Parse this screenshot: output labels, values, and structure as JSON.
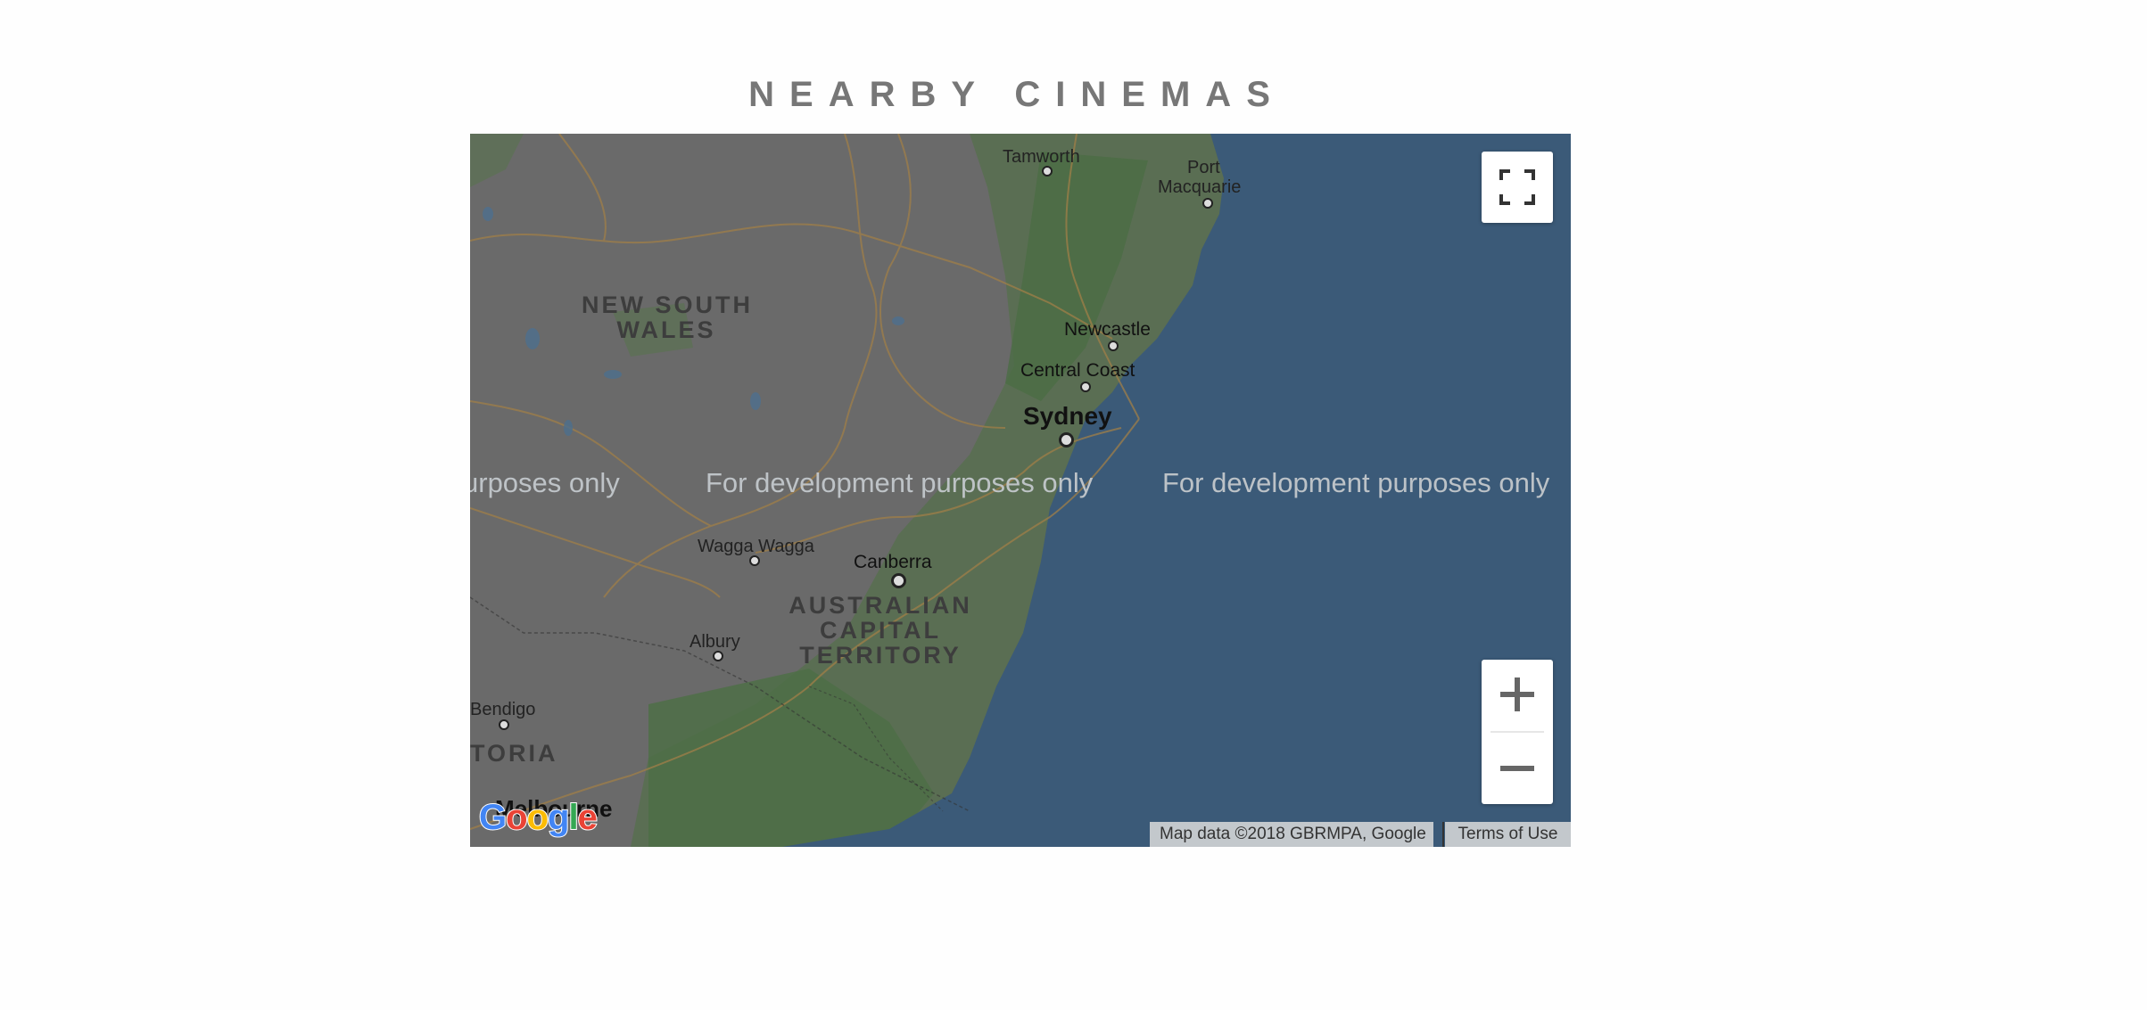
{
  "page": {
    "title": "NEARBY CINEMAS"
  },
  "map": {
    "labels": {
      "tamworth": "Tamworth",
      "port_macquarie_1": "Port",
      "port_macquarie_2": "Macquarie",
      "nsw_1": "NEW SOUTH",
      "nsw_2": "WALES",
      "newcastle": "Newcastle",
      "central_coast": "Central Coast",
      "sydney": "Sydney",
      "wagga_wagga": "Wagga Wagga",
      "canberra": "Canberra",
      "act_1": "AUSTRALIAN",
      "act_2": "CAPITAL",
      "act_3": "TERRITORY",
      "albury": "Albury",
      "bendigo": "Bendigo",
      "victoria": "TORIA",
      "melbourne": "Melbourne"
    },
    "watermarks": [
      "urposes only",
      "For development purposes only",
      "For development purposes only"
    ],
    "attribution": "Map data ©2018 GBRMPA, Google",
    "terms": "Terms of Use",
    "logo": [
      "G",
      "o",
      "o",
      "g",
      "l",
      "e"
    ],
    "colors": {
      "land": "#6a6a6a",
      "forest": "#4f6f48",
      "water": "#3b5a78",
      "roads": "#9a7a45",
      "logo_blue": "#4285f4",
      "logo_red": "#ea4335",
      "logo_yellow": "#fbbc05",
      "logo_green": "#34a853"
    },
    "icons": {
      "fullscreen": "fullscreen-icon",
      "zoom_in": "plus-icon",
      "zoom_out": "minus-icon"
    }
  }
}
